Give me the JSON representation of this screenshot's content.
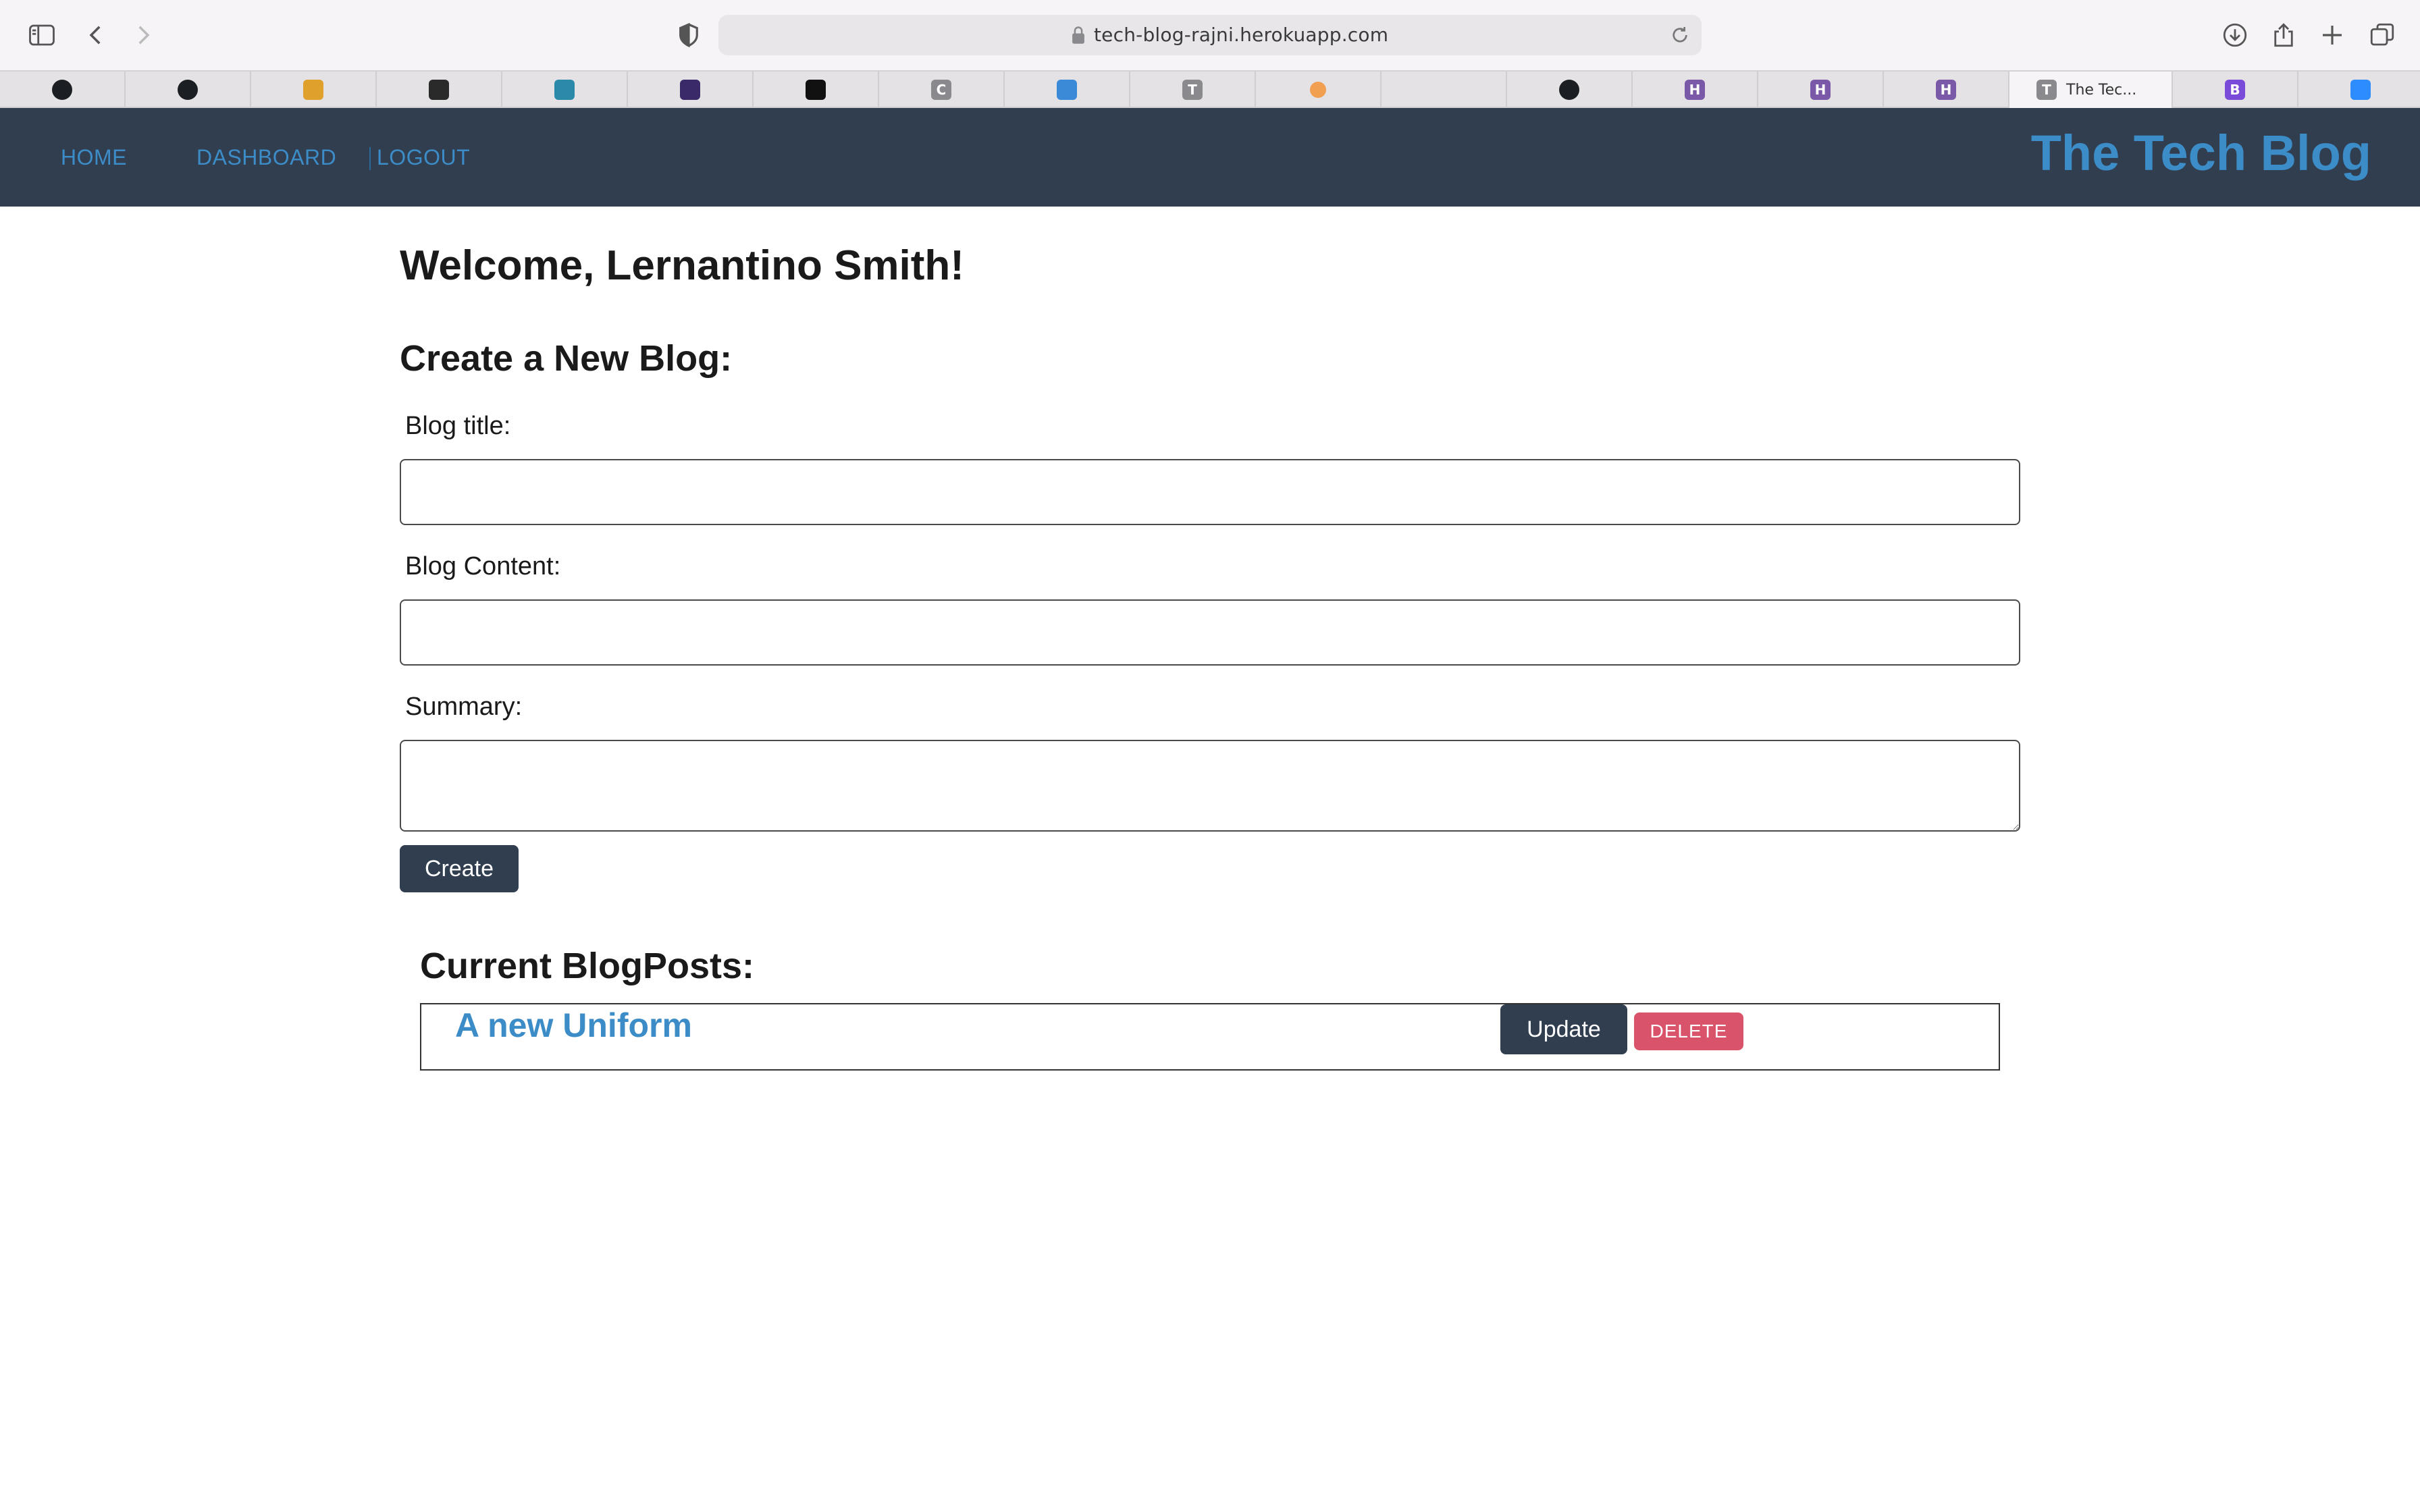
{
  "browser": {
    "url": "tech-blog-rajni.herokuapp.com",
    "active_tab_title": "The Tec...",
    "tabs": [
      {
        "icon": "github-icon",
        "color": "#1b1f23",
        "glyph": ""
      },
      {
        "icon": "github-icon",
        "color": "#1b1f23",
        "glyph": ""
      },
      {
        "icon": "orange-grid-icon",
        "color": "#e0a02c",
        "glyph": ""
      },
      {
        "icon": "dark-square-icon",
        "color": "#2a2a2a",
        "glyph": ""
      },
      {
        "icon": "teal-home-icon",
        "color": "#2a8aa8",
        "glyph": ""
      },
      {
        "icon": "purple-square-icon",
        "color": "#3a2a6a",
        "glyph": ""
      },
      {
        "icon": "medium-icon",
        "color": "#111111",
        "glyph": ""
      },
      {
        "icon": "gray-c-icon",
        "color": "#8a8a8e",
        "glyph": "C"
      },
      {
        "icon": "blue-cube-icon",
        "color": "#3a8ad8",
        "glyph": ""
      },
      {
        "icon": "gray-t-icon",
        "color": "#8a8a8e",
        "glyph": "T"
      },
      {
        "icon": "orange-dot-icon",
        "color": "#f0a050",
        "glyph": ""
      },
      {
        "icon": "blank-icon",
        "color": "transparent",
        "glyph": ""
      },
      {
        "icon": "github-icon",
        "color": "#1b1f23",
        "glyph": ""
      },
      {
        "icon": "heroku-icon",
        "color": "#7a5aa8",
        "glyph": "H"
      },
      {
        "icon": "heroku-icon",
        "color": "#7a5aa8",
        "glyph": "H"
      },
      {
        "icon": "heroku-icon",
        "color": "#7a5aa8",
        "glyph": "H"
      },
      {
        "icon": "gray-t-icon",
        "color": "#8a8a8e",
        "glyph": "T"
      },
      {
        "icon": "bootstrap-icon",
        "color": "#7a4ad8",
        "glyph": "B"
      },
      {
        "icon": "zoom-icon",
        "color": "#2d8cff",
        "glyph": ""
      }
    ]
  },
  "nav": {
    "home": "HOME",
    "dashboard": "DASHBOARD",
    "logout": "LOGOUT",
    "brand": "The Tech Blog"
  },
  "main": {
    "welcome": "Welcome, Lernantino Smith!",
    "create_heading": "Create a New Blog:",
    "title_label": "Blog title:",
    "content_label": "Blog Content:",
    "summary_label": "Summary:",
    "title_value": "",
    "content_value": "",
    "summary_value": "",
    "create_button": "Create",
    "current_heading": "Current BlogPosts:",
    "posts": [
      {
        "title": "A new Uniform",
        "update_label": "Update",
        "delete_label": "DELETE"
      }
    ]
  },
  "colors": {
    "navbar": "#313e50",
    "link": "#3c8cc8",
    "delete": "#d9536a"
  }
}
